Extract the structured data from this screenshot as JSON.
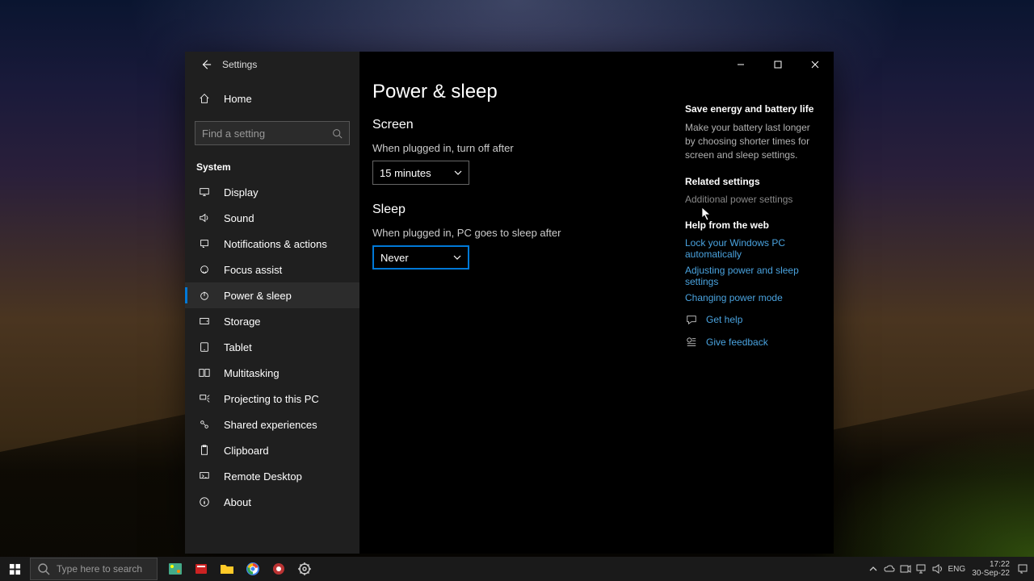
{
  "window": {
    "title": "Settings",
    "home_label": "Home",
    "search_placeholder": "Find a setting",
    "category": "System"
  },
  "nav": [
    {
      "icon": "display",
      "label": "Display"
    },
    {
      "icon": "sound",
      "label": "Sound"
    },
    {
      "icon": "notifications",
      "label": "Notifications & actions"
    },
    {
      "icon": "focus",
      "label": "Focus assist"
    },
    {
      "icon": "power",
      "label": "Power & sleep",
      "selected": true
    },
    {
      "icon": "storage",
      "label": "Storage"
    },
    {
      "icon": "tablet",
      "label": "Tablet"
    },
    {
      "icon": "multitasking",
      "label": "Multitasking"
    },
    {
      "icon": "projecting",
      "label": "Projecting to this PC"
    },
    {
      "icon": "shared",
      "label": "Shared experiences"
    },
    {
      "icon": "clipboard",
      "label": "Clipboard"
    },
    {
      "icon": "remote",
      "label": "Remote Desktop"
    },
    {
      "icon": "about",
      "label": "About"
    }
  ],
  "page": {
    "title": "Power & sleep",
    "screen": {
      "heading": "Screen",
      "label": "When plugged in, turn off after",
      "value": "15 minutes"
    },
    "sleep": {
      "heading": "Sleep",
      "label": "When plugged in, PC goes to sleep after",
      "value": "Never"
    }
  },
  "aside": {
    "energy_title": "Save energy and battery life",
    "energy_text": "Make your battery last longer by choosing shorter times for screen and sleep settings.",
    "related_title": "Related settings",
    "related_link": "Additional power settings",
    "webhelp_title": "Help from the web",
    "webhelp_links": [
      "Lock your Windows PC automatically",
      "Adjusting power and sleep settings",
      "Changing power mode"
    ],
    "get_help": "Get help",
    "give_feedback": "Give feedback"
  },
  "taskbar": {
    "search_placeholder": "Type here to search",
    "lang": "ENG",
    "time": "17:22",
    "date": "30-Sep-22"
  }
}
